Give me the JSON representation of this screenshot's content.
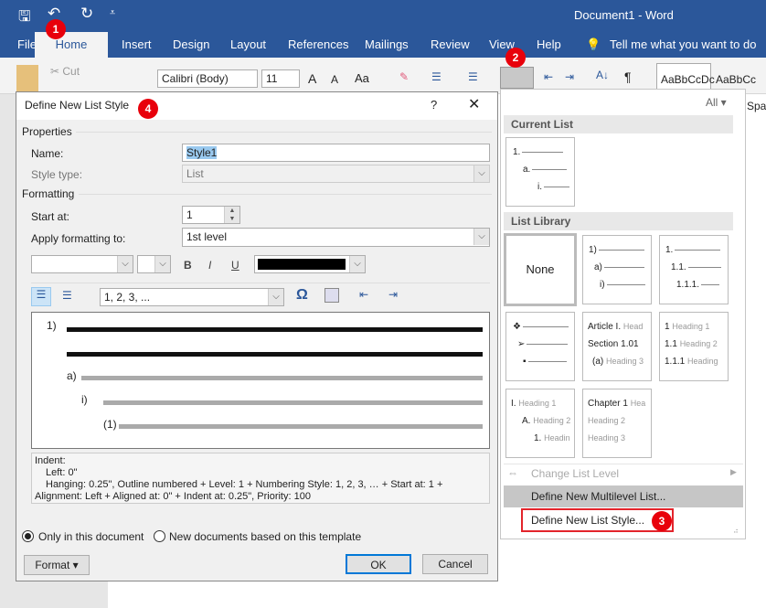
{
  "titlebar": {
    "title": "Document1  -  Word"
  },
  "tabs": [
    "File",
    "Home",
    "Insert",
    "Design",
    "Layout",
    "References",
    "Mailings",
    "Review",
    "View",
    "Help"
  ],
  "tell_me": "Tell me what you want to do",
  "ribbon": {
    "cut": "Cut",
    "font": "Calibri (Body)",
    "size": "11",
    "styles_preview": "AaBbCcDc",
    "styles_preview2": "AaBbCc",
    "spacing": "Spa"
  },
  "badges": [
    "1",
    "2",
    "3",
    "4"
  ],
  "dialog": {
    "title": "Define New List Style",
    "help": "?",
    "properties": "Properties",
    "name_label": "Name:",
    "name_value": "Style1",
    "style_type_label": "Style type:",
    "style_type_value": "List",
    "formatting": "Formatting",
    "start_at_label": "Start at:",
    "start_at_value": "1",
    "apply_label": "Apply formatting to:",
    "apply_value": "1st level",
    "bold": "B",
    "italic": "I",
    "underline": "U",
    "font_color": "#000000",
    "numbering_style": "1, 2, 3, ...",
    "omega": "Ω",
    "preview": {
      "l1": "1)",
      "l2": "a)",
      "l3": "i)",
      "l4": "(1)"
    },
    "description": [
      "Indent:",
      "Left:  0\"",
      "Hanging:  0.25\", Outline numbered + Level: 1 + Numbering Style: 1, 2, 3, … + Start at: 1 +",
      "Alignment: Left + Aligned at:  0\" + Indent at:  0.25\", Priority: 100"
    ],
    "radio_only": "Only in this document",
    "radio_only_checked": true,
    "radio_new": "New documents based on this template",
    "format_btn": "Format",
    "ok": "OK",
    "cancel": "Cancel"
  },
  "panel": {
    "filter": "All",
    "current_list": "Current List",
    "list_library": "List Library",
    "current": [
      "1.",
      "a.",
      "i."
    ],
    "none": "None",
    "lib2": [
      "1)",
      "a)",
      "i)"
    ],
    "lib3": [
      "1.",
      "1.1.",
      "1.1.1."
    ],
    "lib5": [
      [
        "Article I.",
        "Head"
      ],
      [
        "Section 1.01",
        ""
      ],
      [
        "(a)",
        "Heading 3"
      ]
    ],
    "lib6": [
      [
        "1",
        "Heading 1"
      ],
      [
        "1.1",
        "Heading 2"
      ],
      [
        "1.1.1",
        "Heading"
      ]
    ],
    "lib7": [
      [
        "I.",
        "Heading 1"
      ],
      [
        "A.",
        "Heading 2"
      ],
      [
        "1.",
        "Headin"
      ]
    ],
    "lib8": [
      [
        "Chapter 1",
        "Hea"
      ],
      [
        "",
        "Heading 2"
      ],
      [
        "",
        "Heading 3"
      ]
    ],
    "change_level": "Change List Level",
    "define_multilevel": "Define New Multilevel List...",
    "define_style": "Define New List Style...",
    "highlight": "#e3242b"
  }
}
